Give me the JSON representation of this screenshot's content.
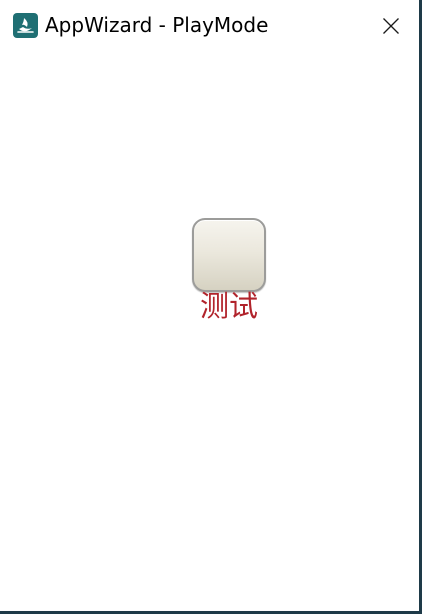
{
  "window": {
    "title": "AppWizard - PlayMode",
    "app_icon": "appwizard-logo-icon",
    "close_icon": "close-icon"
  },
  "canvas": {
    "button": {
      "label": "测试",
      "label_color": "#b1232b"
    }
  },
  "colors": {
    "accent": "#1f6f73",
    "border": "#1e3a48"
  }
}
